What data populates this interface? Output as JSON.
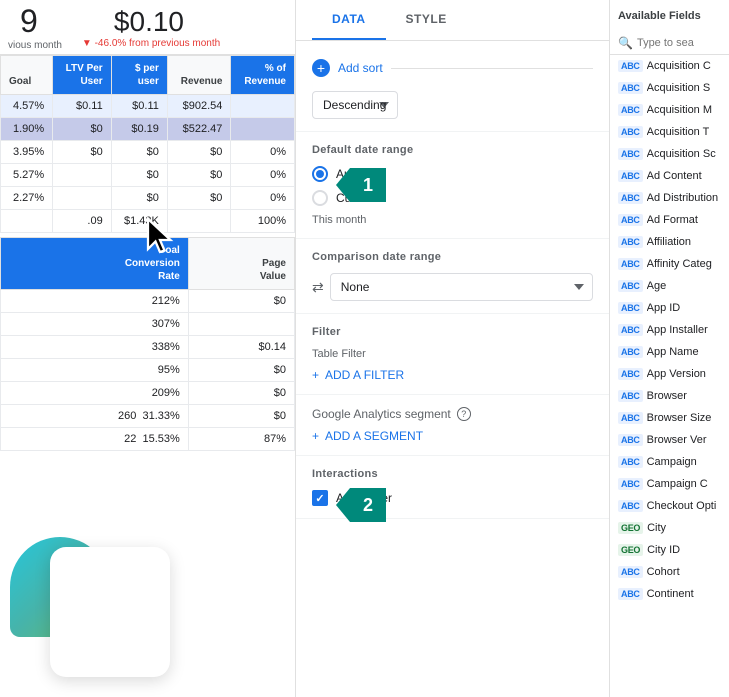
{
  "header": {
    "metric1": "9",
    "metric1_sublabel": "vious month",
    "metric2": "$0.10",
    "metric2_change": "▼ -46.0% from previous month"
  },
  "table": {
    "columns": [
      "Goal",
      "LTV Per User",
      "$ per user",
      "Revenue",
      "% of Revenue"
    ],
    "rows": [
      {
        "goal": "4.57%",
        "ltv": "$0.11",
        "per_user": "$0.11",
        "revenue": "$902.54",
        "pct": ""
      },
      {
        "goal": "1.90%",
        "ltv": "$0",
        "per_user": "$0.19",
        "revenue": "$522.47",
        "pct": ""
      },
      {
        "goal": "3.95%",
        "ltv": "",
        "per_user": "$0",
        "revenue": "$0",
        "pct": "0%"
      },
      {
        "goal": "5.27%",
        "ltv": "",
        "per_user": "$0",
        "revenue": "$0",
        "pct": "0%"
      },
      {
        "goal": "2.27%",
        "ltv": "",
        "per_user": "$0",
        "revenue": "$0",
        "pct": "0%"
      }
    ],
    "footer_row": {
      "ltv": ".09",
      "per_user": "$1.43K",
      "pct": "100%"
    },
    "columns2": [
      "Goal Conversion Rate",
      "Page Value"
    ],
    "rows2": [
      {
        "gcr": "212%",
        "pv": "$0"
      },
      {
        "gcr": "307%",
        "pv": ""
      },
      {
        "gcr": "338%",
        "pv": "$0.14"
      },
      {
        "gcr": "95%",
        "pv": "$0"
      },
      {
        "gcr": "209%",
        "pv": "$0"
      },
      {
        "gcr": "260",
        "extra": "31.33%",
        "pv": "$0"
      },
      {
        "gcr": "22",
        "extra": "15.53%",
        "pv": "87%"
      }
    ]
  },
  "right_panel": {
    "tabs": [
      {
        "label": "DATA",
        "active": true
      },
      {
        "label": "STYLE",
        "active": false
      }
    ],
    "add_sort_label": "Add sort",
    "sort_options": [
      "Descending"
    ],
    "sort_placeholder": "Descending",
    "date_range": {
      "label": "Default date range",
      "options": [
        {
          "label": "Auto",
          "selected": true
        },
        {
          "label": "Custom",
          "selected": false
        }
      ],
      "this_month_text": "This month"
    },
    "comparison": {
      "label": "Comparison date range",
      "value": "None"
    },
    "filter": {
      "label": "Filter",
      "sub_label": "Table Filter",
      "add_filter_label": "ADD A FILTER"
    },
    "segment": {
      "label": "Google Analytics segment",
      "add_segment_label": "ADD A SEGMENT"
    },
    "interactions": {
      "label": "Interactions",
      "apply_filter_label": "Apply filter",
      "checked": true
    }
  },
  "fields_panel": {
    "title": "Available Fields",
    "search_placeholder": "Type to sea",
    "fields": [
      {
        "type": "ABC",
        "name": "Acquisition C",
        "color": "blue"
      },
      {
        "type": "ABC",
        "name": "Acquisition S",
        "color": "blue"
      },
      {
        "type": "ABC",
        "name": "Acquisition M",
        "color": "blue"
      },
      {
        "type": "ABC",
        "name": "Acquisition T",
        "color": "blue"
      },
      {
        "type": "ABC",
        "name": "Acquisition Sc",
        "color": "blue"
      },
      {
        "type": "ABC",
        "name": "Ad Content",
        "color": "blue"
      },
      {
        "type": "ABC",
        "name": "Ad Distribution",
        "color": "blue"
      },
      {
        "type": "ABC",
        "name": "Ad Format",
        "color": "blue"
      },
      {
        "type": "ABC",
        "name": "Affiliation",
        "color": "blue"
      },
      {
        "type": "ABC",
        "name": "Affinity Categ",
        "color": "blue"
      },
      {
        "type": "ABC",
        "name": "Age",
        "color": "blue"
      },
      {
        "type": "ABC",
        "name": "App ID",
        "color": "blue"
      },
      {
        "type": "ABC",
        "name": "App Installer",
        "color": "blue"
      },
      {
        "type": "ABC",
        "name": "App Name",
        "color": "blue"
      },
      {
        "type": "ABC",
        "name": "App Version",
        "color": "blue"
      },
      {
        "type": "ABC",
        "name": "Browser",
        "color": "blue"
      },
      {
        "type": "ABC",
        "name": "Browser Size",
        "color": "blue"
      },
      {
        "type": "ABC",
        "name": "Browser Ver",
        "color": "blue"
      },
      {
        "type": "ABC",
        "name": "Campaign",
        "color": "blue"
      },
      {
        "type": "ABC",
        "name": "Campaign C",
        "color": "blue"
      },
      {
        "type": "ABC",
        "name": "Checkout Opti",
        "color": "blue"
      },
      {
        "type": "GEO",
        "name": "City",
        "color": "green"
      },
      {
        "type": "GEO",
        "name": "City ID",
        "color": "green"
      },
      {
        "type": "ABC",
        "name": "Cohort",
        "color": "blue"
      },
      {
        "type": "ABC",
        "name": "Continent",
        "color": "blue"
      }
    ]
  },
  "steps": {
    "step1_label": "1",
    "step2_label": "2"
  }
}
